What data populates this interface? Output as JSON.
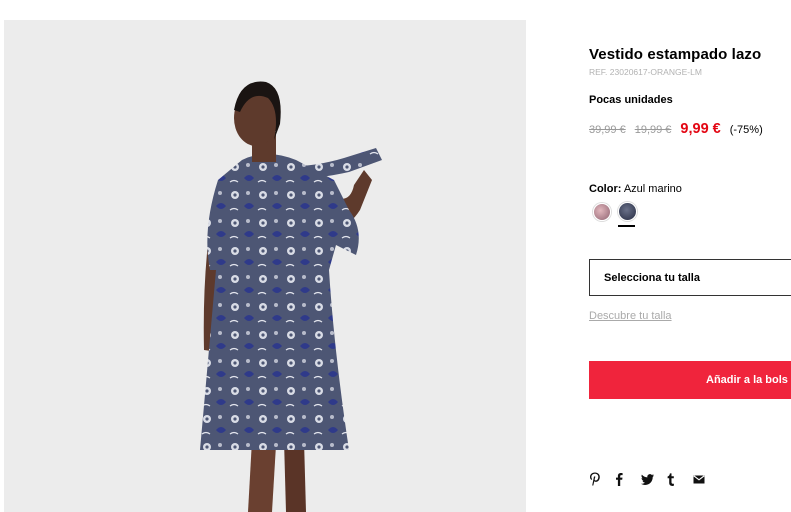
{
  "product": {
    "title": "Vestido estampado lazo",
    "ref": "REF. 23020617-ORANGE-LM",
    "stock_status": "Pocas unidades",
    "price_original": "39,99 €",
    "price_previous": "19,99 €",
    "price_current": "9,99 €",
    "discount": "(-75%)"
  },
  "color": {
    "label": "Color:",
    "selected": "Azul marino",
    "swatches": [
      "pink-print",
      "navy-print"
    ]
  },
  "size": {
    "select_label": "Selecciona tu talla",
    "guide_link": "Descubre tu talla"
  },
  "actions": {
    "add_to_bag": "Añadir a la bols"
  },
  "share_icons": [
    "pinterest-icon",
    "facebook-icon",
    "twitter-icon",
    "tumblr-icon",
    "email-icon"
  ],
  "colors": {
    "accent_red": "#e30613",
    "button_red": "#f0243c",
    "photo_bg": "#ececec",
    "dress": "#4a5372"
  }
}
